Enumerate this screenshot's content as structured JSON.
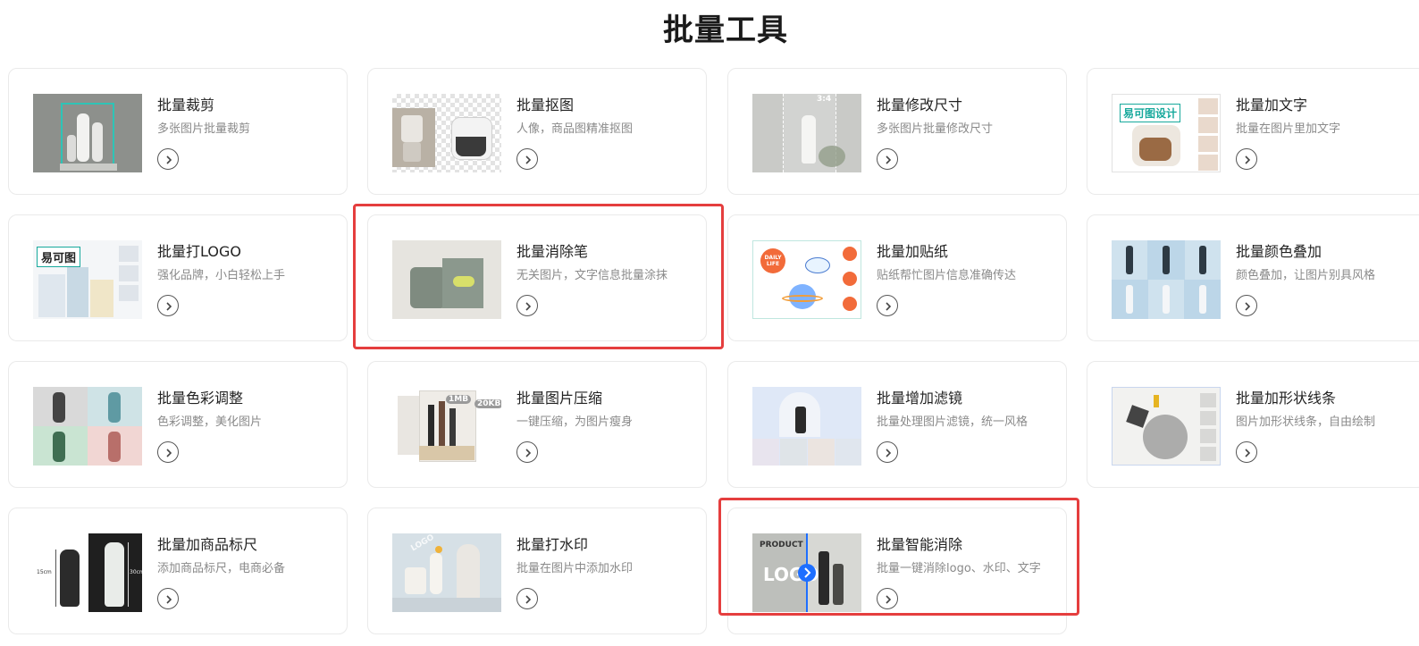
{
  "page": {
    "title": "批量工具"
  },
  "colors": {
    "highlight": "#e53e3e",
    "accent_blue": "#1e6fff",
    "card_border": "#eaeaea"
  },
  "tools": [
    {
      "title": "批量裁剪",
      "desc": "多张图片批量裁剪"
    },
    {
      "title": "批量抠图",
      "desc": "人像，商品图精准抠图"
    },
    {
      "title": "批量修改尺寸",
      "desc": "多张图片批量修改尺寸",
      "thumb_label": "3:4"
    },
    {
      "title": "批量加文字",
      "desc": "批量在图片里加文字",
      "thumb_label": "易可图设计"
    },
    {
      "title": "批量打LOGO",
      "desc": "强化品牌，小白轻松上手",
      "thumb_label": "易可图"
    },
    {
      "title": "批量消除笔",
      "desc": "无关图片，文字信息批量涂抹"
    },
    {
      "title": "批量加贴纸",
      "desc": "贴纸帮忙图片信息准确传达",
      "thumb_label": "DAILY LIFE"
    },
    {
      "title": "批量颜色叠加",
      "desc": "颜色叠加，让图片别具风格"
    },
    {
      "title": "批量色彩调整",
      "desc": "色彩调整，美化图片"
    },
    {
      "title": "批量图片压缩",
      "desc": "一键压缩，为图片瘦身",
      "thumb_label": "1MB",
      "thumb_label2": "20KB"
    },
    {
      "title": "批量增加滤镜",
      "desc": "批量处理图片滤镜，统一风格"
    },
    {
      "title": "批量加形状线条",
      "desc": "图片加形状线条，自由绘制"
    },
    {
      "title": "批量加商品标尺",
      "desc": "添加商品标尺，电商必备",
      "thumb_label": "15cm",
      "thumb_label2": "30cm"
    },
    {
      "title": "批量打水印",
      "desc": "批量在图片中添加水印",
      "thumb_label": "LOGO"
    },
    {
      "title": "批量智能消除",
      "desc": "批量一键消除logo、水印、文字",
      "thumb_label": "PRODUCT",
      "thumb_label2": "LOGO"
    }
  ]
}
